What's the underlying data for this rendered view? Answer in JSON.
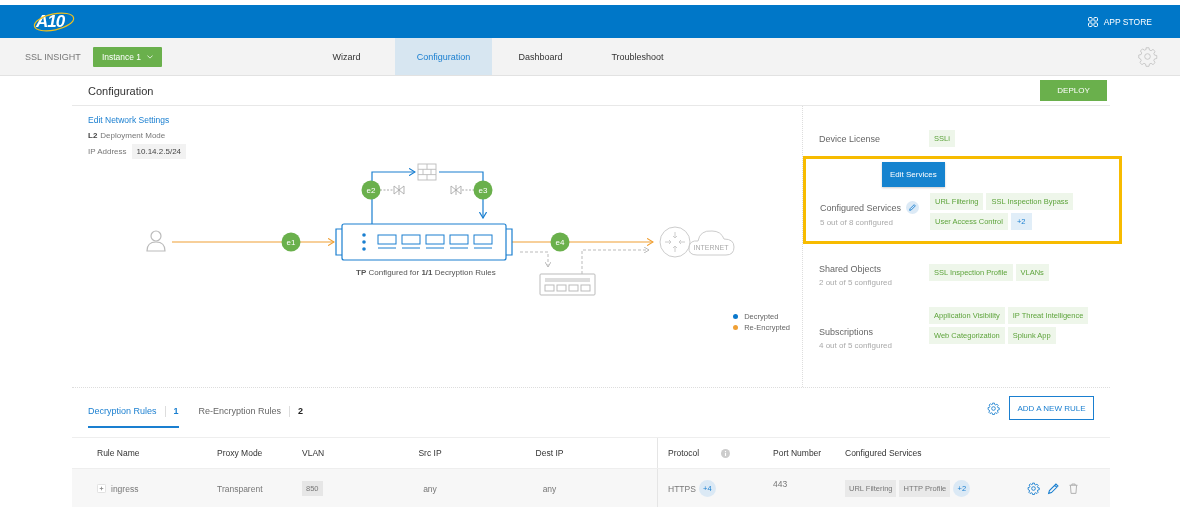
{
  "header": {
    "logo": "A10",
    "app_store": "APP STORE"
  },
  "nav": {
    "product": "SSL INSIGHT",
    "instance": "Instance 1",
    "tabs": [
      {
        "label": "Wizard",
        "selected": false
      },
      {
        "label": "Configuration",
        "selected": true
      },
      {
        "label": "Dashboard",
        "selected": false
      },
      {
        "label": "Troubleshoot",
        "selected": false
      }
    ]
  },
  "page": {
    "title": "Configuration",
    "deploy": "DEPLOY"
  },
  "network": {
    "edit_link": "Edit Network Settings",
    "mode_value": "L2",
    "mode_label": "Deployment Mode",
    "ip_label": "IP Address",
    "ip_value": "10.14.2.5/24"
  },
  "diagram": {
    "ports": [
      "e1",
      "e2",
      "e3",
      "e4"
    ],
    "caption": "**TP** Configured for **1/1** Decryption Rules",
    "internet": "INTERNET",
    "legend": [
      {
        "label": "Decrypted",
        "color": "#0a78cc"
      },
      {
        "label": "Re-Encrypted",
        "color": "#f0a035"
      }
    ]
  },
  "summary": [
    {
      "title": "Device License",
      "highlighted": false,
      "tags": [
        {
          "label": "SSLi",
          "kind": "tag"
        }
      ]
    },
    {
      "title": "Configured Services",
      "subtitle": "5 out of 8 configured",
      "highlighted": true,
      "tooltip": "Edit Services",
      "tags": [
        {
          "label": "URL Filtering",
          "kind": "tag"
        },
        {
          "label": "SSL Inspection Bypass",
          "kind": "tag"
        },
        {
          "label": "User Access Control",
          "kind": "tag"
        },
        {
          "label": "+2",
          "kind": "more"
        }
      ]
    },
    {
      "title": "Shared Objects",
      "subtitle": "2 out of 5 configured",
      "highlighted": false,
      "tags": [
        {
          "label": "SSL Inspection Profile",
          "kind": "tag"
        },
        {
          "label": "VLANs",
          "kind": "tag"
        }
      ]
    },
    {
      "title": "Subscriptions",
      "subtitle": "4 out of 5 configured",
      "highlighted": false,
      "tags": [
        {
          "label": "Application Visibility",
          "kind": "tag"
        },
        {
          "label": "IP Threat Intelligence",
          "kind": "tag"
        },
        {
          "label": "Web Categorization",
          "kind": "tag"
        },
        {
          "label": "Splunk App",
          "kind": "tag"
        }
      ]
    }
  ],
  "rule_tabs": [
    {
      "label": "Decryption Rules",
      "count": "1",
      "selected": true
    },
    {
      "label": "Re-Encryption Rules",
      "count": "2",
      "selected": false
    }
  ],
  "add_rule": "ADD A NEW RULE",
  "table": {
    "columns": [
      "Rule Name",
      "Proxy Mode",
      "VLAN",
      "Src IP",
      "Dest IP",
      "Protocol",
      "Port Number",
      "Configured Services"
    ],
    "rows": [
      {
        "rule_name": "ingress",
        "proxy_mode": "Transparent",
        "vlan": "850",
        "src_ip": "any",
        "dest_ip": "any",
        "protocol": "HTTPS",
        "protocol_more": "+4",
        "port": "443",
        "services": [
          "URL Filtering",
          "HTTP Profile"
        ],
        "services_more": "+2"
      }
    ]
  }
}
